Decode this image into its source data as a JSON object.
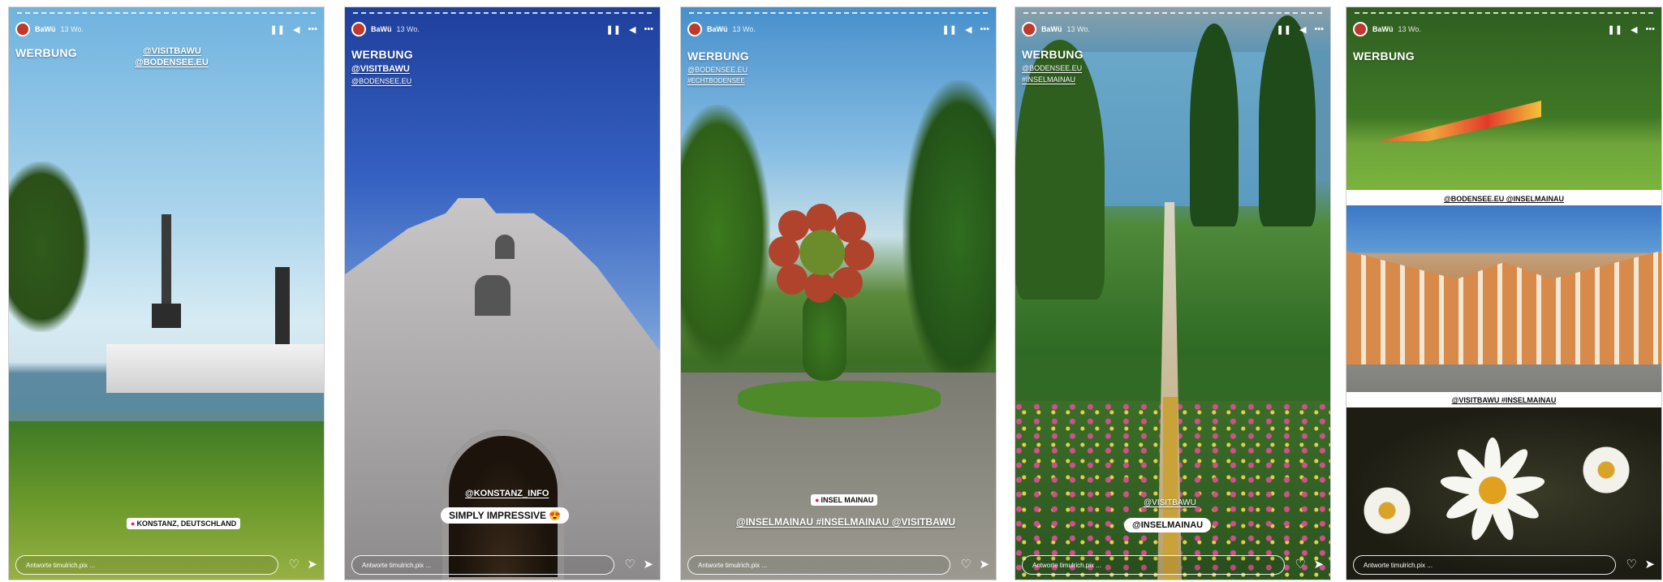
{
  "user": "BaWü",
  "age": "13 Wo.",
  "werbung": "WERBUNG",
  "reply_placeholder": "Antworte timulrich.pix ...",
  "icons": {
    "pause": "pause-icon",
    "mute": "speaker-icon",
    "more": "more-icon",
    "heart": "heart-icon",
    "send": "send-icon",
    "pin": "location-pin-icon"
  },
  "stories": {
    "s1": {
      "tag1": "@VISITBAWU",
      "tag2": "@BODENSEE.EU",
      "location": "KONSTANZ, DEUTSCHLAND"
    },
    "s2": {
      "tag1": "@VISITBAWU",
      "tag2": "@BODENSEE.EU",
      "mention": "@KONSTANZ_INFO",
      "sticker": "SIMPLY IMPRESSIVE 😍"
    },
    "s3": {
      "tag1": "@BODENSEE.EU",
      "tag2": "#ECHTBODENSEE",
      "location": "INSEL MAINAU",
      "caption": "@INSELMAINAU #INSELMAINAU @VISITBAWU"
    },
    "s4": {
      "tag1": "@BODENSEE.EU",
      "tag2": "#INSELMAINAU",
      "mention": "@VISITBAWU",
      "sticker": "@INSELMAINAU"
    },
    "s5": {
      "caption1": "@BODENSEE.EU @INSELMAINAU",
      "caption2": "@VISITBAWU #INSELMAINAU"
    }
  }
}
